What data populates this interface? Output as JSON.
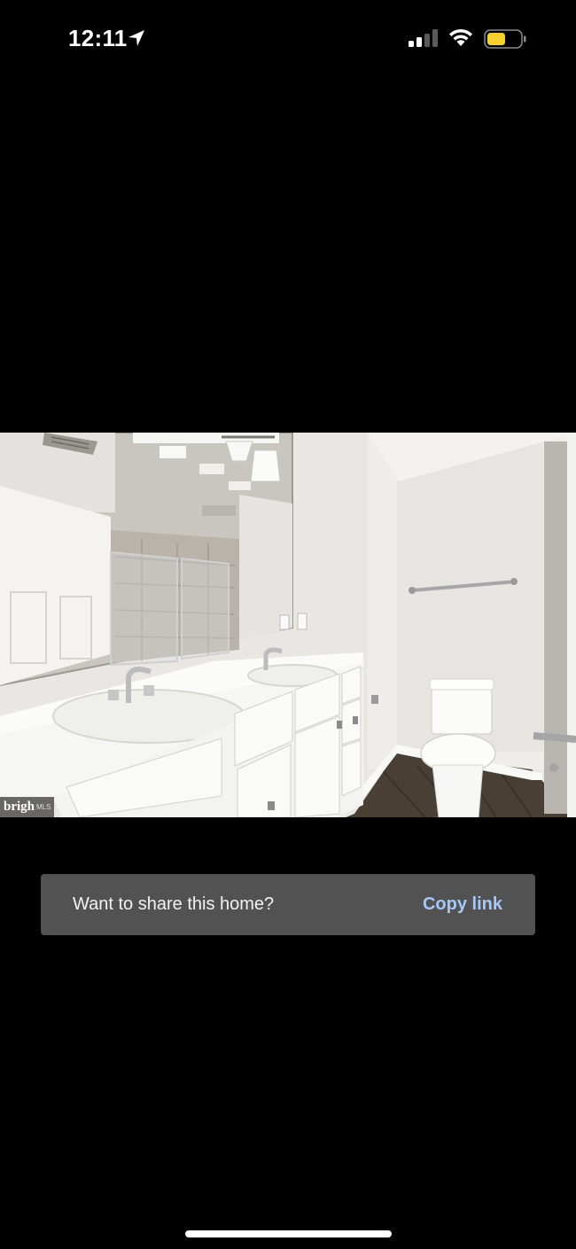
{
  "status_bar": {
    "time": "12:11",
    "battery_color": "#f5d130"
  },
  "photo": {
    "watermark_main": "brigh",
    "watermark_sub": "MLS"
  },
  "share_toast": {
    "message": "Want to share this home?",
    "action_label": "Copy link",
    "action_color": "#a7c7f7"
  }
}
